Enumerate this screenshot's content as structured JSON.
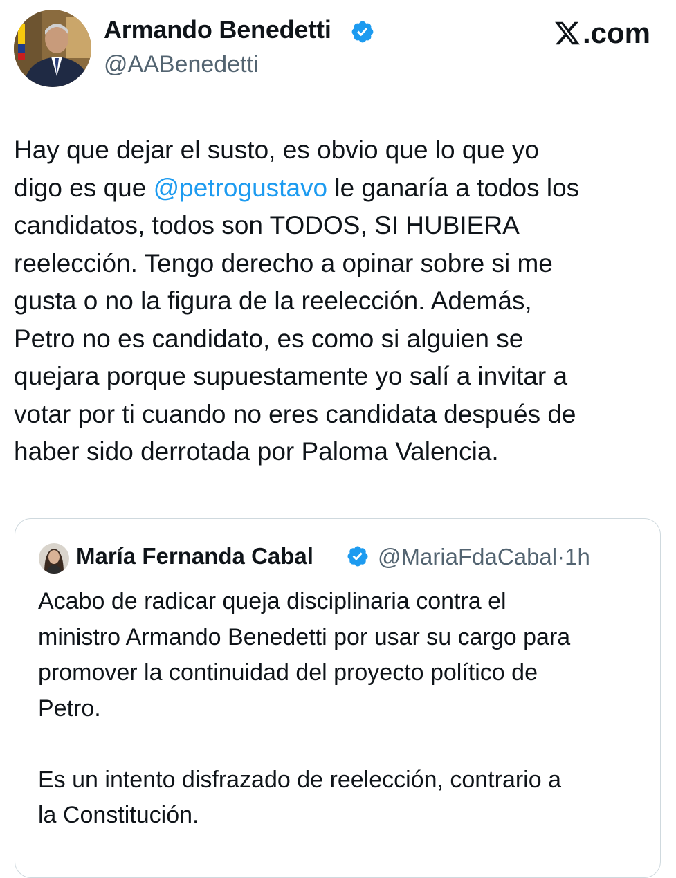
{
  "brand": {
    "label": ".com"
  },
  "tweet": {
    "author": {
      "name": "Armando Benedetti",
      "handle": "@AABenedetti"
    },
    "lines": [
      [
        "Hay que dejar el susto, es obvio que lo que yo"
      ],
      [
        "digo es que ",
        "@petrogustavo",
        " le ganaría a todos los"
      ],
      [
        "candidatos, todos son TODOS, SI HUBIERA"
      ],
      [
        "reelección. Tengo derecho a opinar sobre si me"
      ],
      [
        "gusta o no la figura de la reelección. Además,"
      ],
      [
        "Petro no es candidato, es como si alguien se"
      ],
      [
        "quejara porque supuestamente yo salí a invitar a"
      ],
      [
        "votar por ti cuando no eres candidata después de"
      ],
      [
        "haber sido derrotada por Paloma Valencia."
      ]
    ]
  },
  "quoted": {
    "author": {
      "name": "María Fernanda Cabal",
      "handle": "@MariaFdaCabal",
      "separator": "·",
      "time": "1h"
    },
    "paragraph1": [
      "Acabo de radicar queja disciplinaria contra el",
      "ministro Armando Benedetti por usar su cargo para",
      "promover la continuidad del proyecto político de",
      "Petro."
    ],
    "paragraph2": [
      "Es un intento disfrazado de reelección, contrario a",
      "la Constitución."
    ]
  },
  "colors": {
    "accent": "#1d9bf0",
    "text": "#0f1419",
    "muted": "#536471",
    "border": "#cfd9de"
  },
  "icons": {
    "verified": "verified-badge-icon",
    "x_logo": "x-logo-icon"
  }
}
